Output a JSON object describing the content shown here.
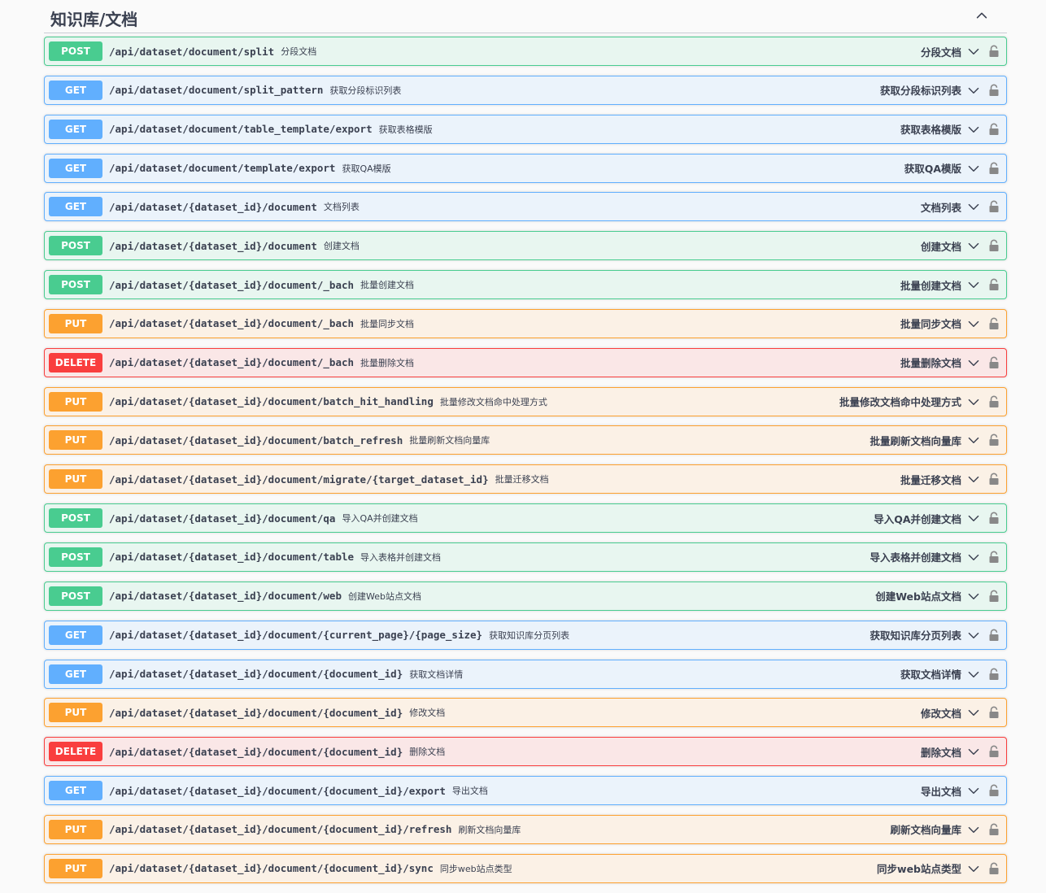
{
  "section": {
    "title": "知识库/文档",
    "toggle_icon": "chevron-up-icon"
  },
  "colors": {
    "get": "#61affe",
    "post": "#49cc90",
    "put": "#fca130",
    "delete": "#f93e3e"
  },
  "operations": [
    {
      "method": "POST",
      "path": "/api/dataset/document/split",
      "desc": "分段文档",
      "summary": "分段文档"
    },
    {
      "method": "GET",
      "path": "/api/dataset/document/split_pattern",
      "desc": "获取分段标识列表",
      "summary": "获取分段标识列表"
    },
    {
      "method": "GET",
      "path": "/api/dataset/document/table_template/export",
      "desc": "获取表格模版",
      "summary": "获取表格模版"
    },
    {
      "method": "GET",
      "path": "/api/dataset/document/template/export",
      "desc": "获取QA模版",
      "summary": "获取QA模版"
    },
    {
      "method": "GET",
      "path": "/api/dataset/{dataset_id}/document",
      "desc": "文档列表",
      "summary": "文档列表"
    },
    {
      "method": "POST",
      "path": "/api/dataset/{dataset_id}/document",
      "desc": "创建文档",
      "summary": "创建文档"
    },
    {
      "method": "POST",
      "path": "/api/dataset/{dataset_id}/document/_bach",
      "desc": "批量创建文档",
      "summary": "批量创建文档"
    },
    {
      "method": "PUT",
      "path": "/api/dataset/{dataset_id}/document/_bach",
      "desc": "批量同步文档",
      "summary": "批量同步文档"
    },
    {
      "method": "DELETE",
      "path": "/api/dataset/{dataset_id}/document/_bach",
      "desc": "批量删除文档",
      "summary": "批量删除文档"
    },
    {
      "method": "PUT",
      "path": "/api/dataset/{dataset_id}/document/batch_hit_handling",
      "desc": "批量修改文档命中处理方式",
      "summary": "批量修改文档命中处理方式"
    },
    {
      "method": "PUT",
      "path": "/api/dataset/{dataset_id}/document/batch_refresh",
      "desc": "批量刷新文档向量库",
      "summary": "批量刷新文档向量库"
    },
    {
      "method": "PUT",
      "path": "/api/dataset/{dataset_id}/document/migrate/{target_dataset_id}",
      "desc": "批量迁移文档",
      "summary": "批量迁移文档"
    },
    {
      "method": "POST",
      "path": "/api/dataset/{dataset_id}/document/qa",
      "desc": "导入QA并创建文档",
      "summary": "导入QA并创建文档"
    },
    {
      "method": "POST",
      "path": "/api/dataset/{dataset_id}/document/table",
      "desc": "导入表格并创建文档",
      "summary": "导入表格并创建文档"
    },
    {
      "method": "POST",
      "path": "/api/dataset/{dataset_id}/document/web",
      "desc": "创建Web站点文档",
      "summary": "创建Web站点文档"
    },
    {
      "method": "GET",
      "path": "/api/dataset/{dataset_id}/document/{current_page}/{page_size}",
      "desc": "获取知识库分页列表",
      "summary": "获取知识库分页列表"
    },
    {
      "method": "GET",
      "path": "/api/dataset/{dataset_id}/document/{document_id}",
      "desc": "获取文档详情",
      "summary": "获取文档详情"
    },
    {
      "method": "PUT",
      "path": "/api/dataset/{dataset_id}/document/{document_id}",
      "desc": "修改文档",
      "summary": "修改文档"
    },
    {
      "method": "DELETE",
      "path": "/api/dataset/{dataset_id}/document/{document_id}",
      "desc": "删除文档",
      "summary": "删除文档"
    },
    {
      "method": "GET",
      "path": "/api/dataset/{dataset_id}/document/{document_id}/export",
      "desc": "导出文档",
      "summary": "导出文档"
    },
    {
      "method": "PUT",
      "path": "/api/dataset/{dataset_id}/document/{document_id}/refresh",
      "desc": "刷新文档向量库",
      "summary": "刷新文档向量库"
    },
    {
      "method": "PUT",
      "path": "/api/dataset/{dataset_id}/document/{document_id}/sync",
      "desc": "同步web站点类型",
      "summary": "同步web站点类型"
    }
  ]
}
